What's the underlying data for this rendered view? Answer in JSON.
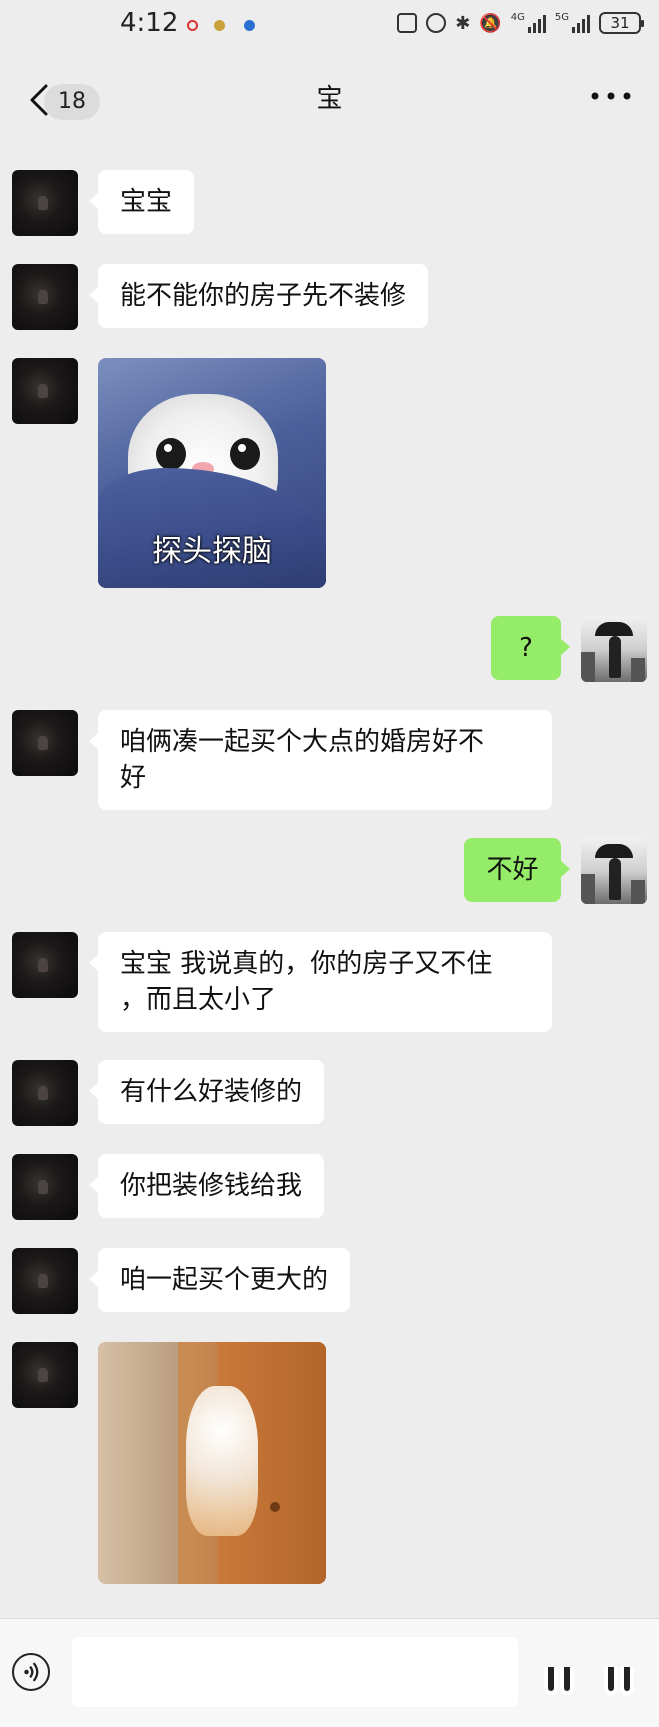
{
  "status_bar": {
    "time": "4:12",
    "battery": "31",
    "network_label": "4G",
    "network_label2": "5G"
  },
  "header": {
    "back_icon": "chevron-left-icon",
    "unread_count": "18",
    "title": "宝",
    "more_icon": "more-dots-icon"
  },
  "messages": [
    {
      "side": "left",
      "type": "text",
      "text": "宝宝"
    },
    {
      "side": "left",
      "type": "text",
      "text": "能不能你的房子先不装修"
    },
    {
      "side": "left",
      "type": "sticker",
      "caption": "探头探脑"
    },
    {
      "side": "right",
      "type": "text",
      "text": "?"
    },
    {
      "side": "left",
      "type": "text",
      "line1": "咱俩凑一起买个大点的婚房好不",
      "line2": "好"
    },
    {
      "side": "right",
      "type": "text",
      "text": "不好"
    },
    {
      "side": "left",
      "type": "text",
      "line1": "宝宝 我说真的，你的房子又不住",
      "line2": "，而且太小了"
    },
    {
      "side": "left",
      "type": "text",
      "text": "有什么好装修的"
    },
    {
      "side": "left",
      "type": "text",
      "text": "你把装修钱给我"
    },
    {
      "side": "left",
      "type": "text",
      "text": "咱一起买个更大的"
    },
    {
      "side": "left",
      "type": "sticker",
      "caption": ""
    }
  ],
  "input_bar": {
    "voice_icon": "voice-icon",
    "emoji_icon": "emoji-icon",
    "plus_icon": "plus-icon"
  },
  "colors": {
    "background": "#ededed",
    "bubble_left": "#ffffff",
    "bubble_right": "#95ec69"
  }
}
